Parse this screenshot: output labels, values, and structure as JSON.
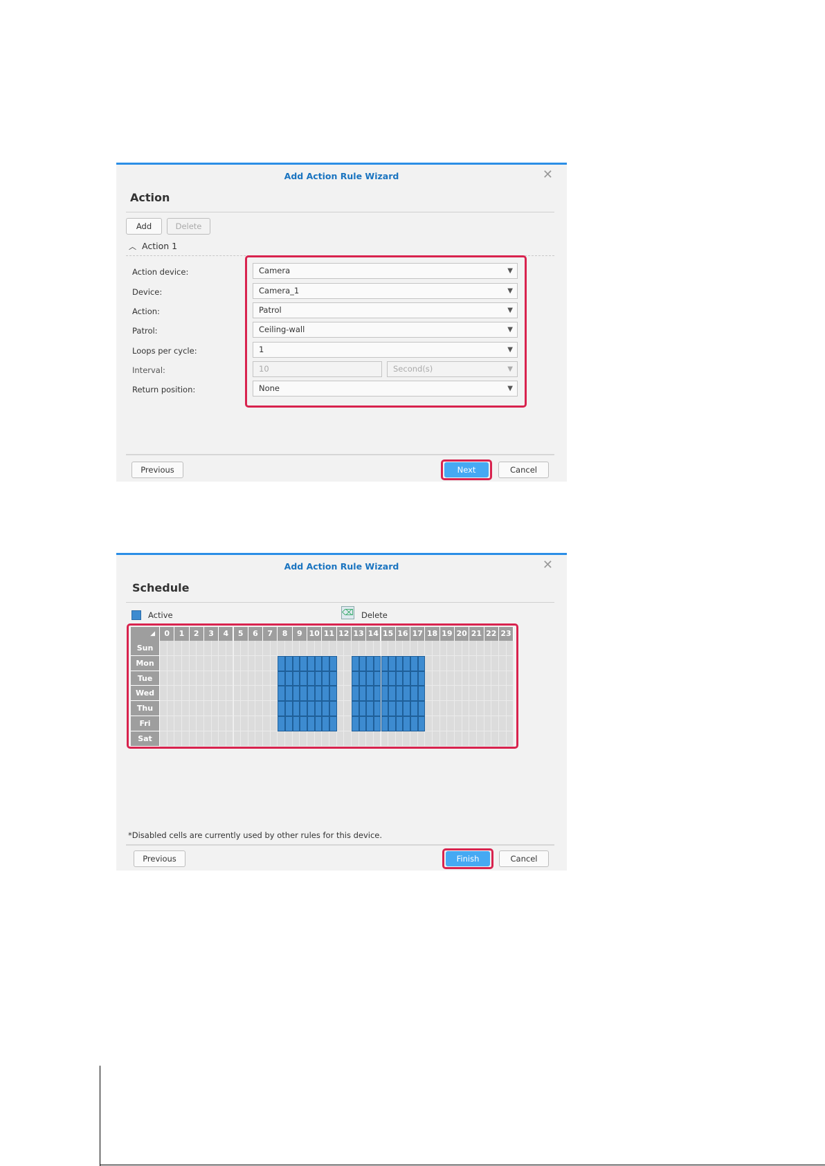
{
  "action_dialog": {
    "title": "Add Action Rule Wizard",
    "section": "Action",
    "add_label": "Add",
    "delete_label": "Delete",
    "group_label": "Action 1",
    "fields": {
      "action_device": {
        "label": "Action device:",
        "value": "Camera"
      },
      "device": {
        "label": "Device:",
        "value": "Camera_1"
      },
      "action": {
        "label": "Action:",
        "value": "Patrol"
      },
      "patrol": {
        "label": "Patrol:",
        "value": "Ceiling-wall"
      },
      "loops": {
        "label": "Loops per cycle:",
        "value": "1"
      },
      "interval": {
        "label": "Interval:",
        "value": "10",
        "unit": "Second(s)"
      },
      "return_position": {
        "label": "Return position:",
        "value": "None"
      }
    },
    "previous_label": "Previous",
    "next_label": "Next",
    "cancel_label": "Cancel"
  },
  "schedule_dialog": {
    "title": "Add Action Rule Wizard",
    "section": "Schedule",
    "legend_active": "Active",
    "legend_delete": "Delete",
    "hours": [
      "0",
      "1",
      "2",
      "3",
      "4",
      "5",
      "6",
      "7",
      "8",
      "9",
      "10",
      "11",
      "12",
      "13",
      "14",
      "15",
      "16",
      "17",
      "18",
      "19",
      "20",
      "21",
      "22",
      "23"
    ],
    "days": [
      "Sun",
      "Mon",
      "Tue",
      "Wed",
      "Thu",
      "Fri",
      "Sat"
    ],
    "active_schedule": {
      "Sun": [],
      "Mon": [
        [
          8,
          12
        ],
        [
          13,
          18
        ]
      ],
      "Tue": [
        [
          8,
          12
        ],
        [
          13,
          18
        ]
      ],
      "Wed": [
        [
          8,
          12
        ],
        [
          13,
          18
        ]
      ],
      "Thu": [
        [
          8,
          12
        ],
        [
          13,
          18
        ]
      ],
      "Fri": [
        [
          8,
          12
        ],
        [
          13,
          18
        ]
      ],
      "Sat": []
    },
    "footnote": "*Disabled cells are currently used by other rules for this device.",
    "previous_label": "Previous",
    "finish_label": "Finish",
    "cancel_label": "Cancel"
  },
  "colors": {
    "accent": "#2b8ee6",
    "active_cell": "#3d8bd0",
    "highlight": "#d8234e",
    "primary_button": "#46a9f3"
  }
}
